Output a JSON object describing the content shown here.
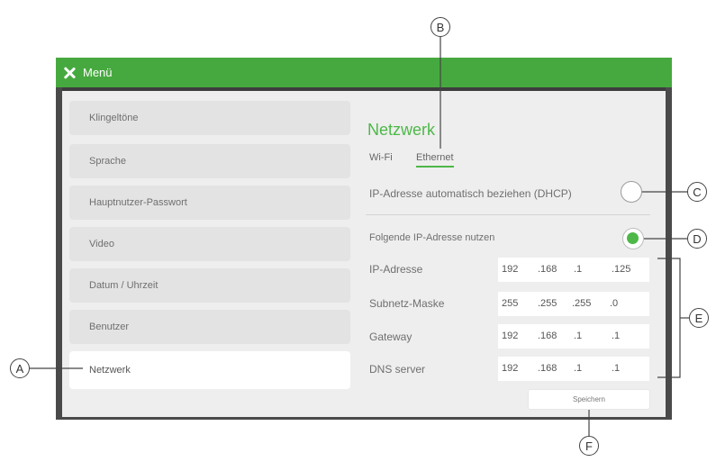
{
  "window": {
    "title": "Menü",
    "accent_color": "#46a93f",
    "close_icon": "close-icon"
  },
  "sidebar": {
    "items": [
      {
        "label": "Klingeltöne"
      },
      {
        "label": "Sprache"
      },
      {
        "label": "Hauptnutzer-Passwort"
      },
      {
        "label": "Video"
      },
      {
        "label": "Datum / Uhrzeit"
      },
      {
        "label": "Benutzer"
      },
      {
        "label": "Netzwerk",
        "selected": true
      }
    ]
  },
  "main": {
    "heading": "Netzwerk",
    "tabs": [
      {
        "label": "Wi-Fi"
      },
      {
        "label": "Ethernet",
        "selected": true
      }
    ],
    "dhcp_option": {
      "label": "IP-Adresse automatisch beziehen (DHCP)",
      "selected": false
    },
    "static_option": {
      "label": "Folgende IP-Adresse nutzen",
      "selected": true
    },
    "fields": [
      {
        "label": "IP-Adresse",
        "octets": [
          "192",
          ".168",
          ".1",
          ".125"
        ]
      },
      {
        "label": "Subnetz-Maske",
        "octets": [
          "255",
          ".255",
          ".255",
          ".0"
        ]
      },
      {
        "label": "Gateway",
        "octets": [
          "192",
          ".168",
          ".1",
          ".1"
        ]
      },
      {
        "label": "DNS server",
        "octets": [
          "192",
          ".168",
          ".1",
          ".1"
        ]
      }
    ],
    "save_label": "Speichern"
  },
  "callouts": {
    "a": "A",
    "b": "B",
    "c": "C",
    "d": "D",
    "e": "E",
    "f": "F"
  }
}
